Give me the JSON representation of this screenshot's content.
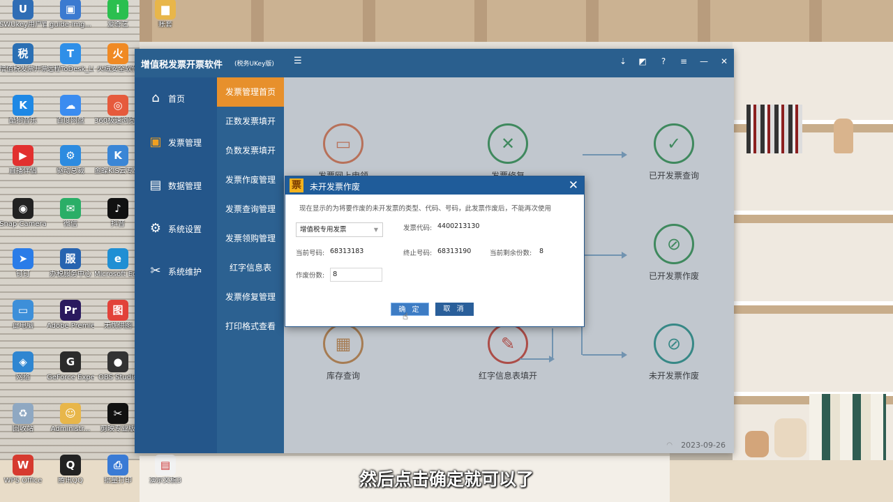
{
  "desktop": {
    "icons": [
      {
        "label": "SWUkey用户管理工具",
        "icon": "ukey-icon",
        "color": "#2f6db5"
      },
      {
        "label": "guide-img...",
        "icon": "image-file-icon",
        "color": "#3b7ad0"
      },
      {
        "label": "爱奇艺",
        "icon": "iqiyi-icon",
        "color": "#2bbf4f"
      },
      {
        "label": "账套",
        "icon": "folder-icon",
        "color": "#e8b64a"
      },
      {
        "label": "增值税发票开票软件（税...",
        "icon": "tax-software-icon",
        "color": "#2a6fb4"
      },
      {
        "label": "远程ToDesk_Lite",
        "icon": "todesk-icon",
        "color": "#2f8fe8"
      },
      {
        "label": "火绒安全软件",
        "icon": "huorong-icon",
        "color": "#f08a24"
      },
      {
        "label": "酷狗音乐",
        "icon": "kugou-icon",
        "color": "#1e88e5"
      },
      {
        "label": "百度网盘",
        "icon": "baidu-netdisk-icon",
        "color": "#3b8cf0"
      },
      {
        "label": "360极速浏览器 (2)",
        "icon": "browser-360-icon",
        "color": "#e65a3c"
      },
      {
        "label": "直播伴侣",
        "icon": "live-companion-icon",
        "color": "#e2302f"
      },
      {
        "label": "驱动总裁",
        "icon": "driver-icon",
        "color": "#2c8be0"
      },
      {
        "label": "金蝶KIS云专业版",
        "icon": "kingdee-icon",
        "color": "#3a86d6"
      },
      {
        "label": "Snap Camera",
        "icon": "snap-camera-icon",
        "color": "#222222"
      },
      {
        "label": "微信",
        "icon": "wechat-icon",
        "color": "#2aae67"
      },
      {
        "label": "抖音",
        "icon": "douyin-icon",
        "color": "#111111"
      },
      {
        "label": "钉钉",
        "icon": "dingtalk-icon",
        "color": "#2a7ce8"
      },
      {
        "label": "办税服务中心",
        "icon": "tax-service-icon",
        "color": "#2764b0"
      },
      {
        "label": "Microsoft Edge",
        "icon": "edge-icon",
        "color": "#1f8fd4"
      },
      {
        "label": "此电脑",
        "icon": "this-pc-icon",
        "color": "#3d8fd9"
      },
      {
        "label": "Adobe Premie...",
        "icon": "premiere-icon",
        "color": "#2a1a5e"
      },
      {
        "label": "无忧供图",
        "icon": "image-tool-icon",
        "color": "#e2423a"
      },
      {
        "label": "网络",
        "icon": "network-icon",
        "color": "#2f86d1"
      },
      {
        "label": "GeForce Experience",
        "icon": "geforce-icon",
        "color": "#2b2b2b"
      },
      {
        "label": "OBS Studio",
        "icon": "obs-icon",
        "color": "#333333"
      },
      {
        "label": "回收站",
        "icon": "recycle-bin-icon",
        "color": "#8fa8c2"
      },
      {
        "label": "Administr...",
        "icon": "user-folder-icon",
        "color": "#e8b64a"
      },
      {
        "label": "剪映专业版",
        "icon": "jianying-icon",
        "color": "#111111"
      },
      {
        "label": "WPS Office",
        "icon": "wps-icon",
        "color": "#d63a2f"
      },
      {
        "label": "腾讯QQ",
        "icon": "qq-icon",
        "color": "#222222"
      },
      {
        "label": "批量打印",
        "icon": "batch-print-icon",
        "color": "#3a7bd5"
      },
      {
        "label": "演示文稿3",
        "icon": "presentation-icon",
        "color": "#f2f2f2"
      }
    ]
  },
  "app": {
    "title": "增值税发票开票软件",
    "subtitle": "(税务UKey版)",
    "nav": [
      {
        "label": "首页",
        "icon": "home-icon"
      },
      {
        "label": "发票管理",
        "icon": "invoice-box-icon",
        "active": true
      },
      {
        "label": "数据管理",
        "icon": "data-icon"
      },
      {
        "label": "系统设置",
        "icon": "settings-icon"
      },
      {
        "label": "系统维护",
        "icon": "maintenance-icon"
      }
    ],
    "subnav": [
      {
        "label": "发票管理首页",
        "active": true
      },
      {
        "label": "正数发票填开"
      },
      {
        "label": "负数发票填开"
      },
      {
        "label": "发票作废管理"
      },
      {
        "label": "发票查询管理"
      },
      {
        "label": "发票领购管理"
      },
      {
        "label": "红字信息表"
      },
      {
        "label": "发票修复管理"
      },
      {
        "label": "打印格式查看"
      }
    ],
    "features": [
      {
        "label": "发票网上申领",
        "icon": "monitor-icon"
      },
      {
        "label": "发票修复",
        "icon": "repair-tools-icon"
      },
      {
        "label": "已开发票查询",
        "icon": "query-check-icon"
      },
      {
        "label": "已开发票作废",
        "icon": "void-issued-icon"
      },
      {
        "label": "库存查询",
        "icon": "inventory-icon"
      },
      {
        "label": "红字信息表填开",
        "icon": "red-form-icon"
      },
      {
        "label": "未开发票作废",
        "icon": "void-unissued-icon"
      }
    ],
    "date": "2023-09-26"
  },
  "dialog": {
    "title": "未开发票作废",
    "logo_char": "票",
    "notice": "现在显示的为将要作废的未开发票的类型、代码、号码，此发票作废后，不能再次使用",
    "invoice_type": "增值税专用发票",
    "invoice_code_label": "发票代码:",
    "invoice_code": "4400213130",
    "current_no_label": "当前号码:",
    "current_no": "68313183",
    "end_no_label": "终止号码:",
    "end_no": "68313190",
    "remaining_label": "当前剩余份数:",
    "remaining": "8",
    "void_count_label": "作废份数:",
    "void_count": "8",
    "ok_label": "确 定",
    "cancel_label": "取 消"
  },
  "caption": "然后点击确定就可以了"
}
